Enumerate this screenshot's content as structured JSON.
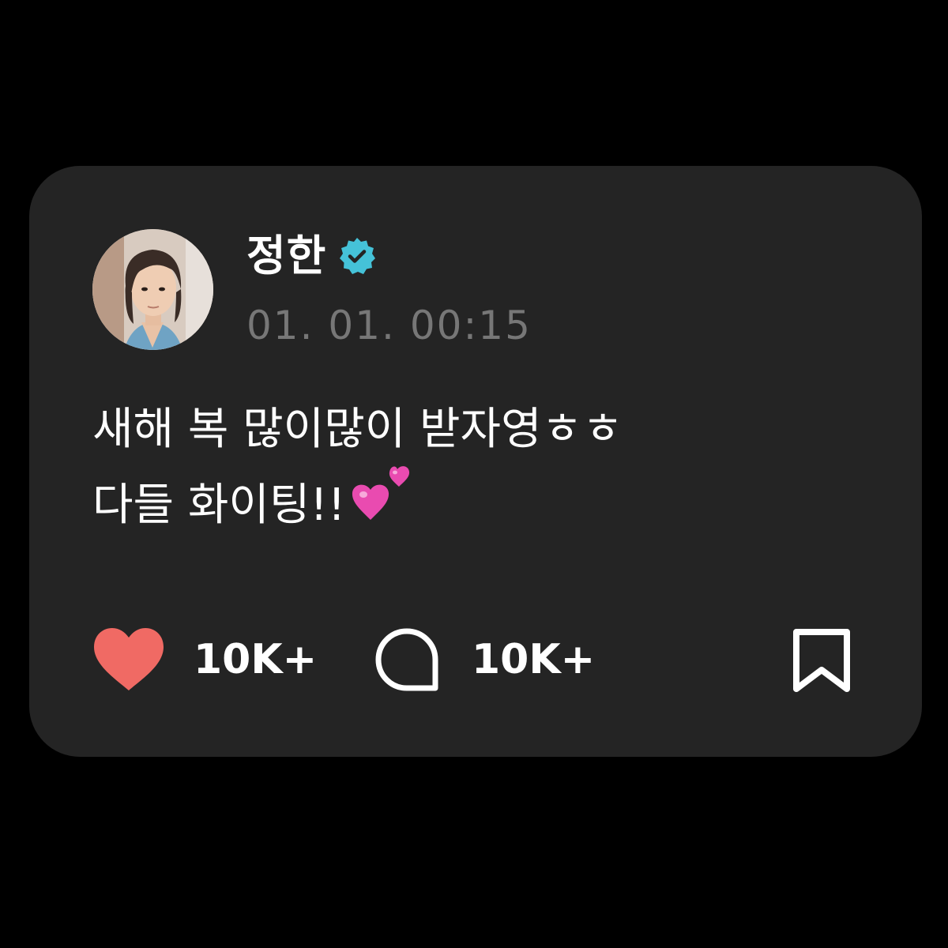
{
  "post": {
    "author": {
      "name": "정한",
      "verified": true,
      "verified_icon": "verified-badge-icon",
      "avatar_icon": "profile-photo"
    },
    "timestamp": "01. 01. 00:15",
    "content": {
      "line1": "새해 복 많이많이 받자영ㅎㅎ",
      "line2": "다들 화이팅!!",
      "line2_emoji": "two-hearts-emoji"
    },
    "actions": {
      "like": {
        "icon": "heart-icon",
        "count": "10K+",
        "color": "#F06A64"
      },
      "comment": {
        "icon": "speech-bubble-icon",
        "count": "10K+"
      },
      "bookmark": {
        "icon": "bookmark-icon"
      }
    }
  },
  "colors": {
    "page_background": "#000000",
    "card_background": "#242424",
    "verified_badge": "#45C2D8",
    "text_primary": "#FFFFFF",
    "text_secondary": "#777777"
  }
}
